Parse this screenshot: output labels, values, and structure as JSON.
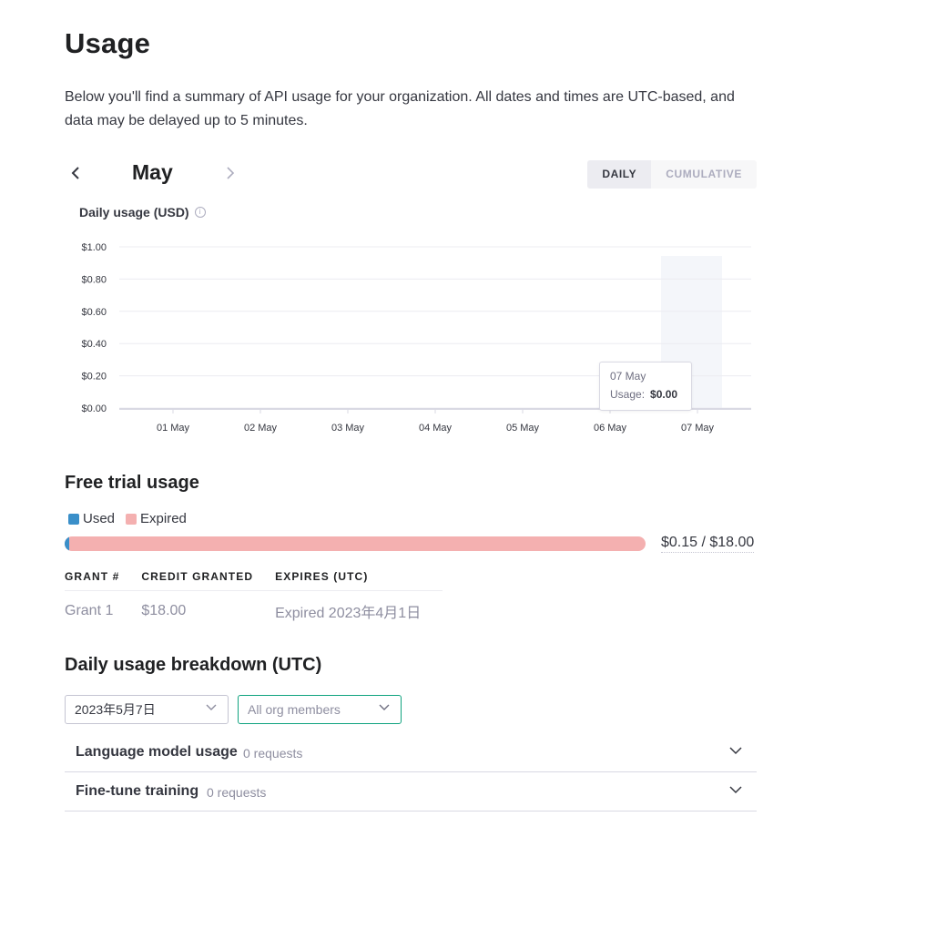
{
  "page": {
    "title": "Usage",
    "intro": "Below you'll find a summary of API usage for your organization. All dates and times are UTC-based, and data may be delayed up to 5 minutes."
  },
  "month_nav": {
    "month": "May",
    "prev_icon": "chevron-left-icon",
    "next_icon": "chevron-right-icon",
    "view_options": [
      {
        "label": "DAILY",
        "active": true
      },
      {
        "label": "CUMULATIVE",
        "active": false
      }
    ]
  },
  "chart": {
    "title": "Daily usage (USD)",
    "info_icon": "info-icon",
    "tooltip": {
      "date": "07 May",
      "usage_label": "Usage:",
      "usage_value": "$0.00"
    }
  },
  "chart_data": {
    "type": "bar",
    "title": "Daily usage (USD)",
    "categories": [
      "01 May",
      "02 May",
      "03 May",
      "04 May",
      "05 May",
      "06 May",
      "07 May"
    ],
    "values": [
      0,
      0,
      0,
      0,
      0,
      0,
      0
    ],
    "y_ticks": [
      "$1.00",
      "$0.80",
      "$0.60",
      "$0.40",
      "$0.20",
      "$0.00"
    ],
    "ylim": [
      0,
      1.0
    ],
    "grid": true,
    "highlighted_category": "07 May"
  },
  "free_trial": {
    "title": "Free trial usage",
    "legend": [
      {
        "label": "Used",
        "color": "#3a8fc9"
      },
      {
        "label": "Expired",
        "color": "#f4b0b0"
      }
    ],
    "used_fraction": 0.0083,
    "total_text": "$0.15 / $18.00",
    "columns": [
      "GRANT #",
      "CREDIT GRANTED",
      "EXPIRES (UTC)"
    ],
    "rows": [
      [
        "Grant 1",
        "$18.00",
        "Expired 2023年4月1日"
      ]
    ]
  },
  "breakdown": {
    "title": "Daily usage breakdown (UTC)",
    "date_value": "2023年5月7日",
    "members_placeholder": "All org members",
    "rows": [
      {
        "title": "Language model usage",
        "count": "0 requests"
      },
      {
        "title": "Fine-tune training",
        "count": "0 requests"
      }
    ]
  }
}
